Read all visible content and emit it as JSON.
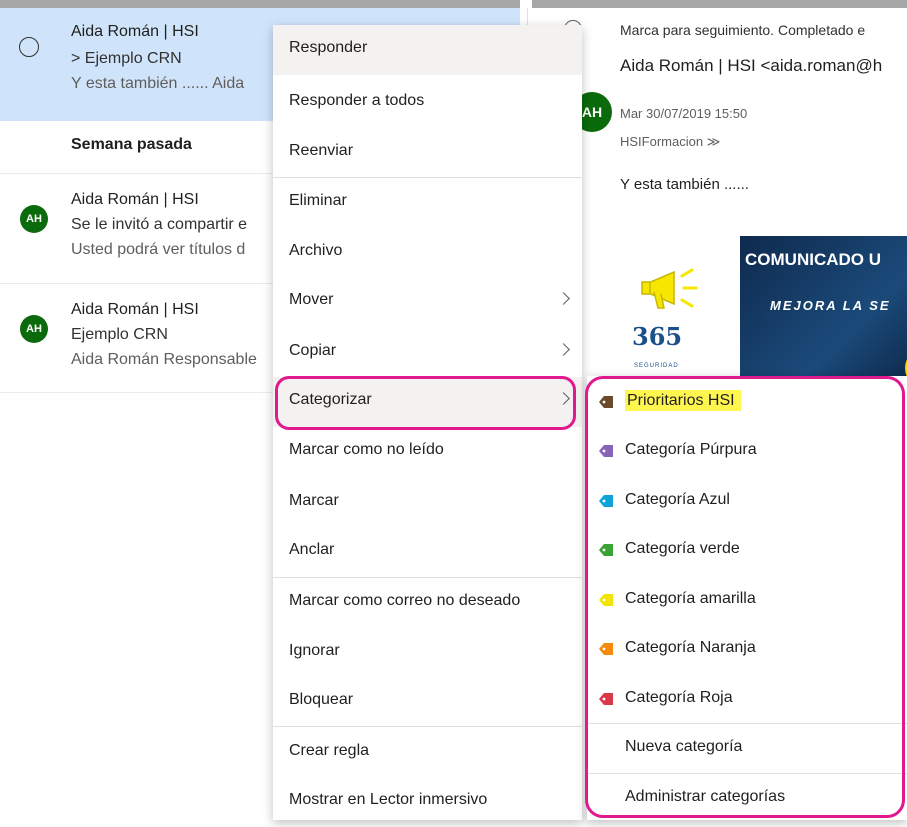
{
  "list": {
    "selected": {
      "sender": "Aida Román | HSI",
      "subject": "> Ejemplo CRN",
      "preview": "Y esta también ...... Aida"
    },
    "section_header": "Semana pasada",
    "items": [
      {
        "avatar": "AH",
        "sender": "Aida Román | HSI",
        "subject": "Se le invitó a compartir e",
        "preview": "Usted podrá ver títulos d"
      },
      {
        "avatar": "AH",
        "sender": "Aida Román | HSI",
        "subject": "Ejemplo CRN",
        "preview": "Aida Román Responsable"
      }
    ]
  },
  "reading": {
    "flag_text": "Marca para seguimiento. Completado e",
    "avatar": "AH",
    "from": "Aida Román | HSI <aida.roman@h",
    "date": "Mar 30/07/2019 15:50",
    "to": "HSIFormacion ≫",
    "body": "Y esta también ......",
    "banner": {
      "title": "COMUNICADO U",
      "subtitle": "MEJORA LA SE",
      "logo": "365",
      "logo_sub": "SEGURIDAD"
    }
  },
  "context_menu": {
    "items": [
      {
        "label": "Responder"
      },
      {
        "label": "Responder a todos"
      },
      {
        "label": "Reenviar"
      },
      {
        "label": "Eliminar"
      },
      {
        "label": "Archivo"
      },
      {
        "label": "Mover"
      },
      {
        "label": "Copiar"
      },
      {
        "label": "Categorizar"
      },
      {
        "label": "Marcar como no leído"
      },
      {
        "label": "Marcar"
      },
      {
        "label": "Anclar"
      },
      {
        "label": "Marcar como correo no deseado"
      },
      {
        "label": "Ignorar"
      },
      {
        "label": "Bloquear"
      },
      {
        "label": "Crear regla"
      },
      {
        "label": "Mostrar en Lector inmersivo"
      }
    ]
  },
  "categories_menu": {
    "items": [
      {
        "label": "Prioritarios HSI",
        "color": "#6b4a2b"
      },
      {
        "label": "Categoría Púrpura",
        "color": "#8764b8"
      },
      {
        "label": "Categoría Azul",
        "color": "#0ea4d8"
      },
      {
        "label": "Categoría verde",
        "color": "#3aa335"
      },
      {
        "label": "Categoría amarilla",
        "color": "#f2e600"
      },
      {
        "label": "Categoría Naranja",
        "color": "#f7890c"
      },
      {
        "label": "Categoría Roja",
        "color": "#d9374a"
      }
    ],
    "new_category": "Nueva categoría",
    "manage_categories": "Administrar categorías"
  },
  "colors": {
    "highlight_ring": "#e0198e",
    "avatar_bg": "#0b6a0b",
    "selected_row_bg": "#cfe4fa"
  }
}
